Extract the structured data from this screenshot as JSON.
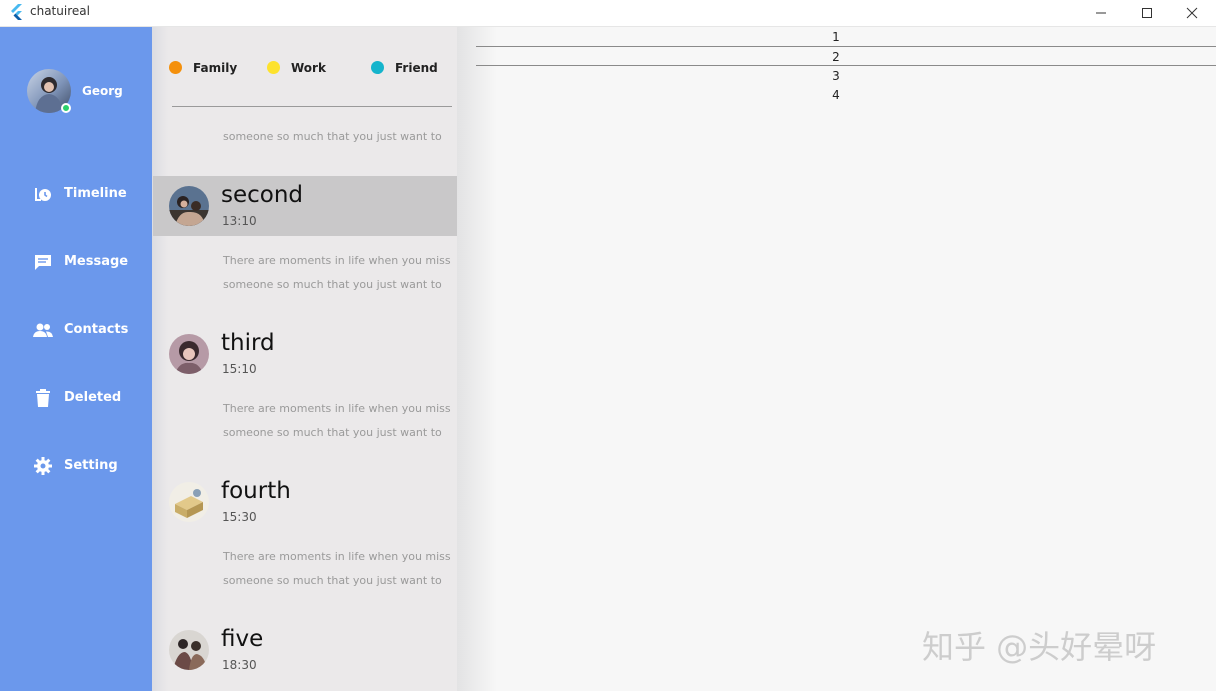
{
  "window": {
    "title": "chatuireal"
  },
  "user": {
    "name": "Georg"
  },
  "nav": [
    {
      "label": "Timeline",
      "icon": "timeline-icon"
    },
    {
      "label": "Message",
      "icon": "message-icon"
    },
    {
      "label": "Contacts",
      "icon": "contacts-icon"
    },
    {
      "label": "Deleted",
      "icon": "trash-icon"
    },
    {
      "label": "Setting",
      "icon": "gear-icon"
    }
  ],
  "categories": [
    {
      "label": "Family",
      "color": "#f4900c"
    },
    {
      "label": "Work",
      "color": "#fde22d"
    },
    {
      "label": "Friend",
      "color": "#15b4cc"
    }
  ],
  "top_preview": "someone so much that you just want to",
  "conversations": [
    {
      "title": "second",
      "time": "13:10",
      "preview_line1": "There are moments in life when you miss",
      "preview_line2": "someone so much that you just want to",
      "selected": true
    },
    {
      "title": "third",
      "time": "15:10",
      "preview_line1": "There are moments in life when you miss",
      "preview_line2": "someone so much that you just want to",
      "selected": false
    },
    {
      "title": "fourth",
      "time": "15:30",
      "preview_line1": "There are moments in life when you miss",
      "preview_line2": "someone so much that you just want to",
      "selected": false
    },
    {
      "title": "five",
      "time": "18:30",
      "selected": false
    }
  ],
  "content_lines": [
    "1",
    "2",
    "3",
    "4"
  ],
  "watermark": "知乎 @头好晕呀"
}
